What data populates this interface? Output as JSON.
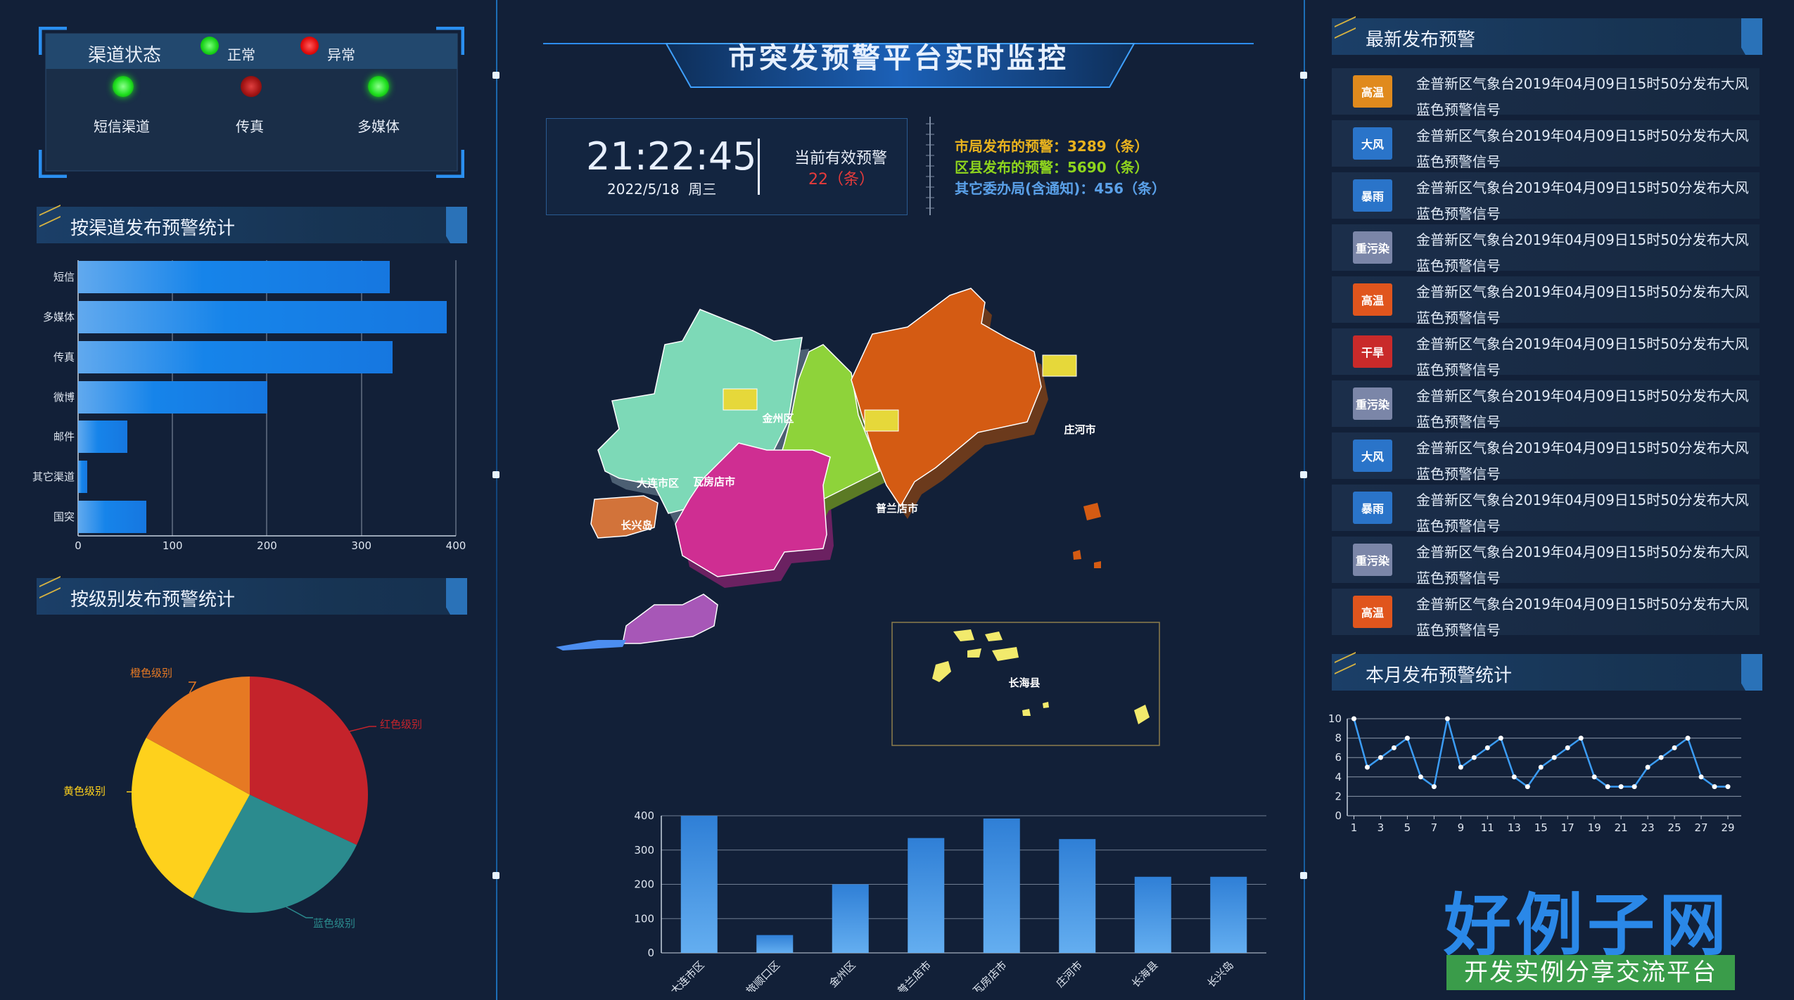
{
  "header": {
    "title": "市突发预警平台实时监控"
  },
  "channel_status": {
    "title": "渠道状态",
    "legend_normal": "正常",
    "legend_abnormal": "异常",
    "items": [
      {
        "label": "短信渠道",
        "status": "正常"
      },
      {
        "label": "传真",
        "status": "异常"
      },
      {
        "label": "多媒体",
        "status": "正常"
      }
    ],
    "colors": {
      "normal": "#1fe01f",
      "abnormal": "#c11a1a"
    }
  },
  "clock": {
    "time": "21:22:45",
    "date": "2022/5/18  周三",
    "active_label": "当前有效预警",
    "active_value": "22（条）"
  },
  "stats": [
    {
      "label": "市局发布的预警：",
      "value": "3289（条）",
      "color": "#e8b21e"
    },
    {
      "label": "区县发布的预警：",
      "value": "5690（条）",
      "color": "#8ed41d"
    },
    {
      "label": "其它委办局(含通知)：",
      "value": "456（条）",
      "color": "#5aa0e8"
    }
  ],
  "channel_chart": {
    "title": "按渠道发布预警统计",
    "chart_data": {
      "type": "bar",
      "orientation": "horizontal",
      "categories": [
        "短信",
        "多媒体",
        "传真",
        "微博",
        "邮件",
        "其它渠道",
        "国突"
      ],
      "values": [
        330,
        390,
        333,
        200,
        52,
        10,
        72
      ],
      "xlim": [
        0,
        400
      ],
      "xticks": [
        "0",
        "100",
        "200",
        "300",
        "400"
      ]
    }
  },
  "level_chart": {
    "title": "按级别发布预警统计",
    "chart_data": {
      "type": "pie",
      "labels": [
        "红色级别",
        "蓝色级别",
        "黄色级别",
        "橙色级别"
      ],
      "values": [
        32,
        26,
        25,
        17
      ],
      "colors": [
        "#c4232b",
        "#2b8b8e",
        "#fed11c",
        "#e67923"
      ]
    }
  },
  "map": {
    "regions": [
      "瓦房店市",
      "普兰店市",
      "庄河市",
      "长兴岛",
      "金州区",
      "大连市区",
      "长海县"
    ],
    "colors": {
      "wafangdian": "#7dd9b7",
      "pulandian": "#8ed33a",
      "zhuanghe": "#d45b13",
      "changxing": "#d2733a",
      "jinzhou": "#cf2e92",
      "dalian": "#a757b7",
      "changhai": "#f2ea6c"
    }
  },
  "district_chart": {
    "chart_data": {
      "type": "bar",
      "categories": [
        "大连市区",
        "旅顺口区",
        "金州区",
        "普兰店市",
        "瓦房店市",
        "庄河市",
        "长海县",
        "长兴岛"
      ],
      "values": [
        400,
        52,
        200,
        335,
        392,
        332,
        222,
        222
      ],
      "ylim": [
        0,
        400
      ],
      "yticks": [
        "0",
        "100",
        "200",
        "300",
        "400"
      ]
    }
  },
  "latest_warnings": {
    "title": "最新发布预警",
    "items": [
      {
        "icon": "heat-warning-icon",
        "icon_text": "高温",
        "color": "#e08a1d",
        "text": "金普新区气象台2019年04月09日15时50分发布大风蓝色预警信号"
      },
      {
        "icon": "gale-warning-icon",
        "icon_text": "大风",
        "color": "#2a74c9",
        "text": "金普新区气象台2019年04月09日15时50分发布大风蓝色预警信号"
      },
      {
        "icon": "rainstorm-warning-icon",
        "icon_text": "暴雨",
        "color": "#2a74c9",
        "text": "金普新区气象台2019年04月09日15时50分发布大风蓝色预警信号"
      },
      {
        "icon": "pollution-warning-icon",
        "icon_text": "重污染",
        "color": "#7b86a8",
        "text": "金普新区气象台2019年04月09日15时50分发布大风蓝色预警信号"
      },
      {
        "icon": "high-temp-warning-icon",
        "icon_text": "高温",
        "color": "#e0551d",
        "text": "金普新区气象台2019年04月09日15时50分发布大风蓝色预警信号"
      },
      {
        "icon": "drought-warning-icon",
        "icon_text": "干旱",
        "color": "#c92a2a",
        "text": "金普新区气象台2019年04月09日15时50分发布大风蓝色预警信号"
      },
      {
        "icon": "pollution-warning-icon",
        "icon_text": "重污染",
        "color": "#7b86a8",
        "text": "金普新区气象台2019年04月09日15时50分发布大风蓝色预警信号"
      },
      {
        "icon": "gale-warning-icon",
        "icon_text": "大风",
        "color": "#2a74c9",
        "text": "金普新区气象台2019年04月09日15时50分发布大风蓝色预警信号"
      },
      {
        "icon": "rainstorm-warning-icon",
        "icon_text": "暴雨",
        "color": "#2a74c9",
        "text": "金普新区气象台2019年04月09日15时50分发布大风蓝色预警信号"
      },
      {
        "icon": "pollution-warning-icon",
        "icon_text": "重污染",
        "color": "#7b86a8",
        "text": "金普新区气象台2019年04月09日15时50分发布大风蓝色预警信号"
      },
      {
        "icon": "high-temp-warning-icon",
        "icon_text": "高温",
        "color": "#e0551d",
        "text": "金普新区气象台2019年04月09日15时50分发布大风蓝色预警信号"
      }
    ]
  },
  "monthly_chart": {
    "title": "本月发布预警统计",
    "chart_data": {
      "type": "line",
      "x": [
        1,
        2,
        3,
        4,
        5,
        6,
        7,
        8,
        9,
        10,
        11,
        12,
        13,
        14,
        15,
        16,
        17,
        18,
        19,
        20,
        21,
        22,
        23,
        24,
        25,
        26,
        27,
        28,
        29
      ],
      "values": [
        10,
        5,
        6,
        7,
        8,
        4,
        3,
        10,
        5,
        6,
        7,
        8,
        4,
        3,
        5,
        6,
        7,
        8,
        4,
        3,
        3,
        3,
        5,
        6,
        7,
        8,
        4,
        3,
        3
      ],
      "ylim": [
        0,
        10
      ],
      "yticks": [
        "0",
        "2",
        "4",
        "6",
        "8",
        "10"
      ],
      "xticks": [
        "1",
        "3",
        "5",
        "7",
        "9",
        "11",
        "13",
        "15",
        "17",
        "19",
        "21",
        "23",
        "25",
        "27",
        "29"
      ]
    }
  },
  "brand": {
    "title": "好例子网",
    "subtitle": "开发实例分享交流平台"
  }
}
